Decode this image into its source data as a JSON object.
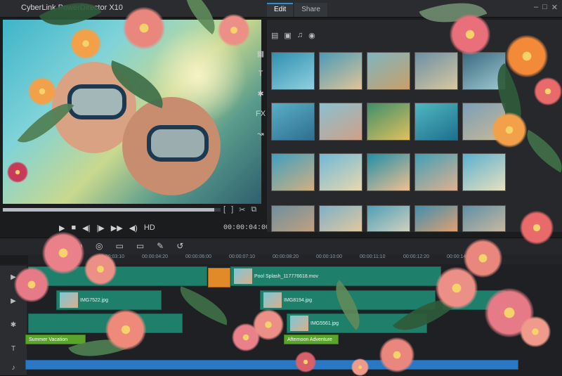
{
  "app": {
    "title": "CyberLink PowerDirector X10"
  },
  "tabs": [
    {
      "label": "Edit"
    },
    {
      "label": "Share"
    }
  ],
  "library": {
    "tool_icons": [
      "folder-icon",
      "image-icon",
      "music-icon",
      "disc-icon"
    ],
    "side_icons": [
      "media-icon",
      "text-icon",
      "effects-icon",
      "fx-icon",
      "transition-icon"
    ]
  },
  "player": {
    "timecode": "00:00:04:00",
    "progress_fraction": 0.97
  },
  "timeline": {
    "ruler_ticks": [
      "00:00:03:10",
      "00:00:04:20",
      "00:00:06:00",
      "00:00:07:10",
      "00:00:08:20",
      "00:00:10:00",
      "00:00:11:10",
      "00:00:12:20",
      "00:00:14:00"
    ],
    "clips": [
      {
        "label": "Pool Splash_117776618.mov"
      },
      {
        "label": "IMG7522.jpg"
      },
      {
        "label": "IMG8194.jpg"
      },
      {
        "label": "IMG5561.jpg"
      }
    ],
    "titles": [
      {
        "label": "Summer Vacation"
      },
      {
        "label": "Afternoon Adventure"
      }
    ]
  },
  "colors": {
    "accent": "#2a8fd6",
    "clip": "#1e7f6b",
    "title_clip": "#5aa42a",
    "audio_clip": "#2a78c4"
  }
}
